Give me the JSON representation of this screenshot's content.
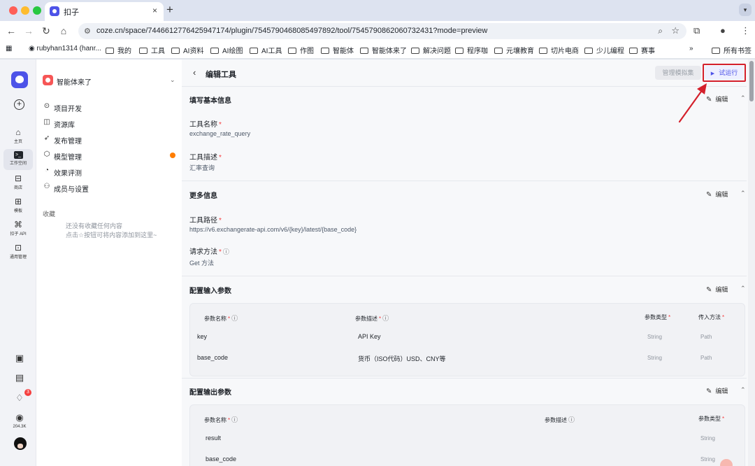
{
  "browser": {
    "tab_title": "扣子",
    "tab_close": "×",
    "new_tab": "+",
    "url": "coze.cn/space/7446612776425947174/plugin/7545790468085497892/tool/7545790862060732431?mode=preview",
    "bookmarks": [
      "rubyhan1314 (hanr...",
      "我的",
      "工具",
      "AI资料",
      "AI绘图",
      "AI工具",
      "作图",
      "智能体",
      "智能体来了",
      "解决问题",
      "程序咖",
      "元壤教育",
      "切片电商",
      "少儿编程",
      "赛事"
    ],
    "bookmarks_more": "»",
    "all_bookmarks": "所有书签"
  },
  "rail": {
    "items": [
      {
        "label": "主页",
        "icon": "home-icon"
      },
      {
        "label": "工作空间",
        "icon": "terminal-icon"
      },
      {
        "label": "商店",
        "icon": "store-icon"
      },
      {
        "label": "模板",
        "icon": "template-icon"
      },
      {
        "label": "扣子 API",
        "icon": "api-icon"
      },
      {
        "label": "通用管理",
        "icon": "briefcase-icon"
      }
    ],
    "notif_count": "3",
    "follower_count": "204.3K"
  },
  "sidebar": {
    "workspace": "智能体来了",
    "items": [
      {
        "label": "项目开发",
        "icon": "gamepad-icon"
      },
      {
        "label": "资源库",
        "icon": "library-icon"
      },
      {
        "label": "发布管理",
        "icon": "rocket-icon"
      },
      {
        "label": "模型管理",
        "icon": "cube-icon"
      },
      {
        "label": "效果评测",
        "icon": "gauge-icon"
      },
      {
        "label": "成员与设置",
        "icon": "members-icon"
      }
    ],
    "favorites_title": "收藏",
    "favorites_empty_line1": "还没有收藏任何内容",
    "favorites_empty_line2": "点击☆按钮可将内容添加到这里~"
  },
  "header": {
    "title": "编辑工具",
    "mock_button": "管理模拟集",
    "run_button": "试运行"
  },
  "sections": {
    "edit_label": "编辑",
    "basic": {
      "title": "填写基本信息",
      "name_label": "工具名称",
      "name_value": "exchange_rate_query",
      "desc_label": "工具描述",
      "desc_value": "汇率查询"
    },
    "more": {
      "title": "更多信息",
      "path_label": "工具路径",
      "path_value": "https://v6.exchangerate-api.com/v6/{key}/latest/{base_code}",
      "method_label": "请求方法",
      "method_value": "Get 方法"
    },
    "input": {
      "title": "配置输入参数",
      "headers": [
        "参数名称",
        "参数描述",
        "参数类型",
        "传入方法"
      ],
      "rows": [
        {
          "name": "key",
          "desc": "API Key",
          "type": "String",
          "method": "Path"
        },
        {
          "name": "base_code",
          "desc": "货币（ISO代码）USD、CNY等",
          "type": "String",
          "method": "Path"
        }
      ]
    },
    "output": {
      "title": "配置输出参数",
      "headers": [
        "参数名称",
        "参数描述",
        "参数类型"
      ],
      "rows": [
        {
          "name": "result",
          "type": "String"
        },
        {
          "name": "base_code",
          "type": "String"
        }
      ]
    }
  },
  "colors": {
    "brand": "#4d53e8",
    "required": "#f53f3f",
    "highlight": "#d4202b"
  }
}
